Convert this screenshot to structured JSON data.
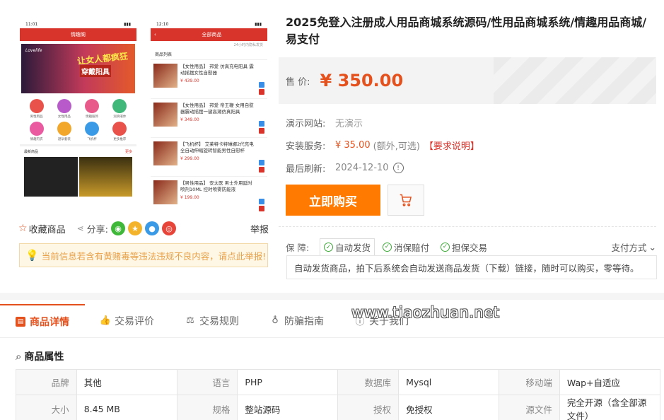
{
  "gallery": {
    "phone_left": {
      "status_time": "11:01",
      "header": "情趣阁",
      "banner": {
        "brand": "Lovelife",
        "slogan1": "让女人都疯狂",
        "slogan2": "穿戴阳具"
      },
      "icons": [
        {
          "label": "男性用品",
          "color": "#e9524a"
        },
        {
          "label": "女性用品",
          "color": "#b85ac9"
        },
        {
          "label": "情趣服饰",
          "color": "#e85a8a"
        },
        {
          "label": "润滑液体",
          "color": "#3fb87a"
        },
        {
          "label": "情趣内衣",
          "color": "#e95aa0"
        },
        {
          "label": "避孕套装",
          "color": "#f3a72a"
        },
        {
          "label": "飞机杯",
          "color": "#3a9ae6"
        },
        {
          "label": "更多推荐",
          "color": "#e9524a"
        }
      ],
      "section_title": "最新商品",
      "section_more": "更多"
    },
    "phone_right": {
      "status_time": "12:10",
      "header": "全部商品",
      "note": "24小时内隐私发货",
      "list_title": "商品列表",
      "items": [
        {
          "name": "【女性用品】 邦爱 仿真充电阳具 震动摇摆女性自慰器",
          "price": "¥ 439.00"
        },
        {
          "name": "【女性用品】 邦爱 帝王鞭 女用自慰器震动摇摆一键高潮仿真阳具",
          "price": "¥ 349.00"
        },
        {
          "name": "【飞机杯】 艾莱特卡特琳娜2代充电全自动伸缩旋转智能男性自慰杯",
          "price": "¥ 299.00"
        },
        {
          "name": "【男性用品】 安太医 男士外用延时喷剂10ML 控时喷雾防能液",
          "price": "¥ 199.00"
        }
      ]
    }
  },
  "actions": {
    "favorite": "收藏商品",
    "share_label": "分享:",
    "report": "举报"
  },
  "notice": "当前信息若含有黄赌毒等违法违规不良内容，请点此举报!",
  "product": {
    "title": "2025免登入注册成人用品商城系统源码/性用品商城系统/情趣用品商城/易支付",
    "price_label": "售 价:",
    "price": "¥ 350.00",
    "demo_label": "演示网站:",
    "demo_value": "无演示",
    "install_label": "安装服务:",
    "install_price": "¥ 35.00",
    "install_note": "(额外,可选)",
    "install_req": "【要求说明】",
    "refresh_label": "最后刷新:",
    "refresh_value": "2024-12-10",
    "buy_label": "立即购买"
  },
  "guarantee": {
    "label": "保 障:",
    "tags": [
      "自动发货",
      "消保赔付",
      "担保交易"
    ],
    "pay_label": "支付方式",
    "desc": "自动发货商品，拍下后系统会自动发送商品发货（下载）链接，随时可以购买，零等待。"
  },
  "tabs": [
    "商品详情",
    "交易评价",
    "交易规则",
    "防骗指南",
    "关于我们"
  ],
  "watermark": "www.tiaozhuan.net",
  "attributes": {
    "title": "商品属性",
    "rows": [
      [
        {
          "k": "品牌",
          "v": "其他"
        },
        {
          "k": "语言",
          "v": "PHP"
        },
        {
          "k": "数据库",
          "v": "Mysql"
        },
        {
          "k": "移动端",
          "v": "Wap+自适应"
        }
      ],
      [
        {
          "k": "大小",
          "v": "8.45 MB"
        },
        {
          "k": "规格",
          "v": "整站源码"
        },
        {
          "k": "授权",
          "v": "免授权"
        },
        {
          "k": "源文件",
          "v": "完全开源（含全部源文件）"
        }
      ]
    ]
  },
  "colors": {
    "accent": "#e5511d",
    "buy": "#ff7a00",
    "phone_header": "#d9342b",
    "check": "#3aaa35"
  }
}
